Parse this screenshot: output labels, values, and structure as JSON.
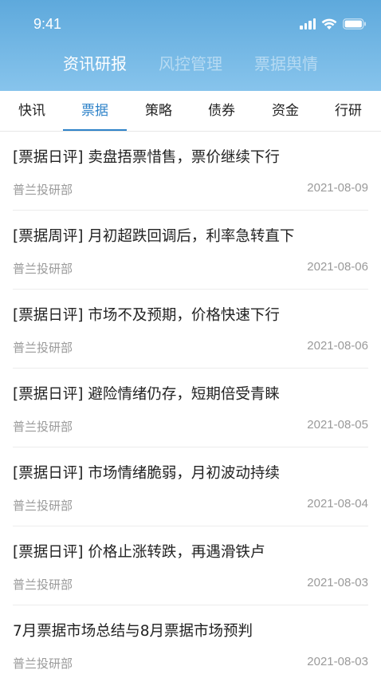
{
  "status_bar": {
    "time": "9:41",
    "icons": [
      "signal-icon",
      "wifi-icon",
      "battery-icon"
    ]
  },
  "top_tabs": [
    {
      "label": "资讯研报",
      "active": true
    },
    {
      "label": "风控管理",
      "active": false
    },
    {
      "label": "票据舆情",
      "active": false
    }
  ],
  "sub_tabs": [
    {
      "label": "快讯",
      "active": false
    },
    {
      "label": "票据",
      "active": true
    },
    {
      "label": "策略",
      "active": false
    },
    {
      "label": "债券",
      "active": false
    },
    {
      "label": "资金",
      "active": false
    },
    {
      "label": "行研",
      "active": false
    }
  ],
  "articles": [
    {
      "title": "[票据日评] 卖盘捂票惜售，票价继续下行",
      "source": "普兰投研部",
      "date": "2021-08-09"
    },
    {
      "title": "[票据周评] 月初超跌回调后，利率急转直下",
      "source": "普兰投研部",
      "date": "2021-08-06"
    },
    {
      "title": "[票据日评] 市场不及预期，价格快速下行",
      "source": "普兰投研部",
      "date": "2021-08-06"
    },
    {
      "title": "[票据日评] 避险情绪仍存，短期倍受青睐",
      "source": "普兰投研部",
      "date": "2021-08-05"
    },
    {
      "title": "[票据日评] 市场情绪脆弱，月初波动持续",
      "source": "普兰投研部",
      "date": "2021-08-04"
    },
    {
      "title": "[票据日评] 价格止涨转跌，再遇滑铁卢",
      "source": "普兰投研部",
      "date": "2021-08-03"
    },
    {
      "title": "7月票据市场总结与8月票据市场预判",
      "source": "普兰投研部",
      "date": "2021-08-03"
    }
  ],
  "colors": {
    "header_gradient_top": "#5ea9dc",
    "header_gradient_bottom": "#87c4ec",
    "accent": "#2f83c9",
    "meta_text": "#9a9a9a"
  }
}
